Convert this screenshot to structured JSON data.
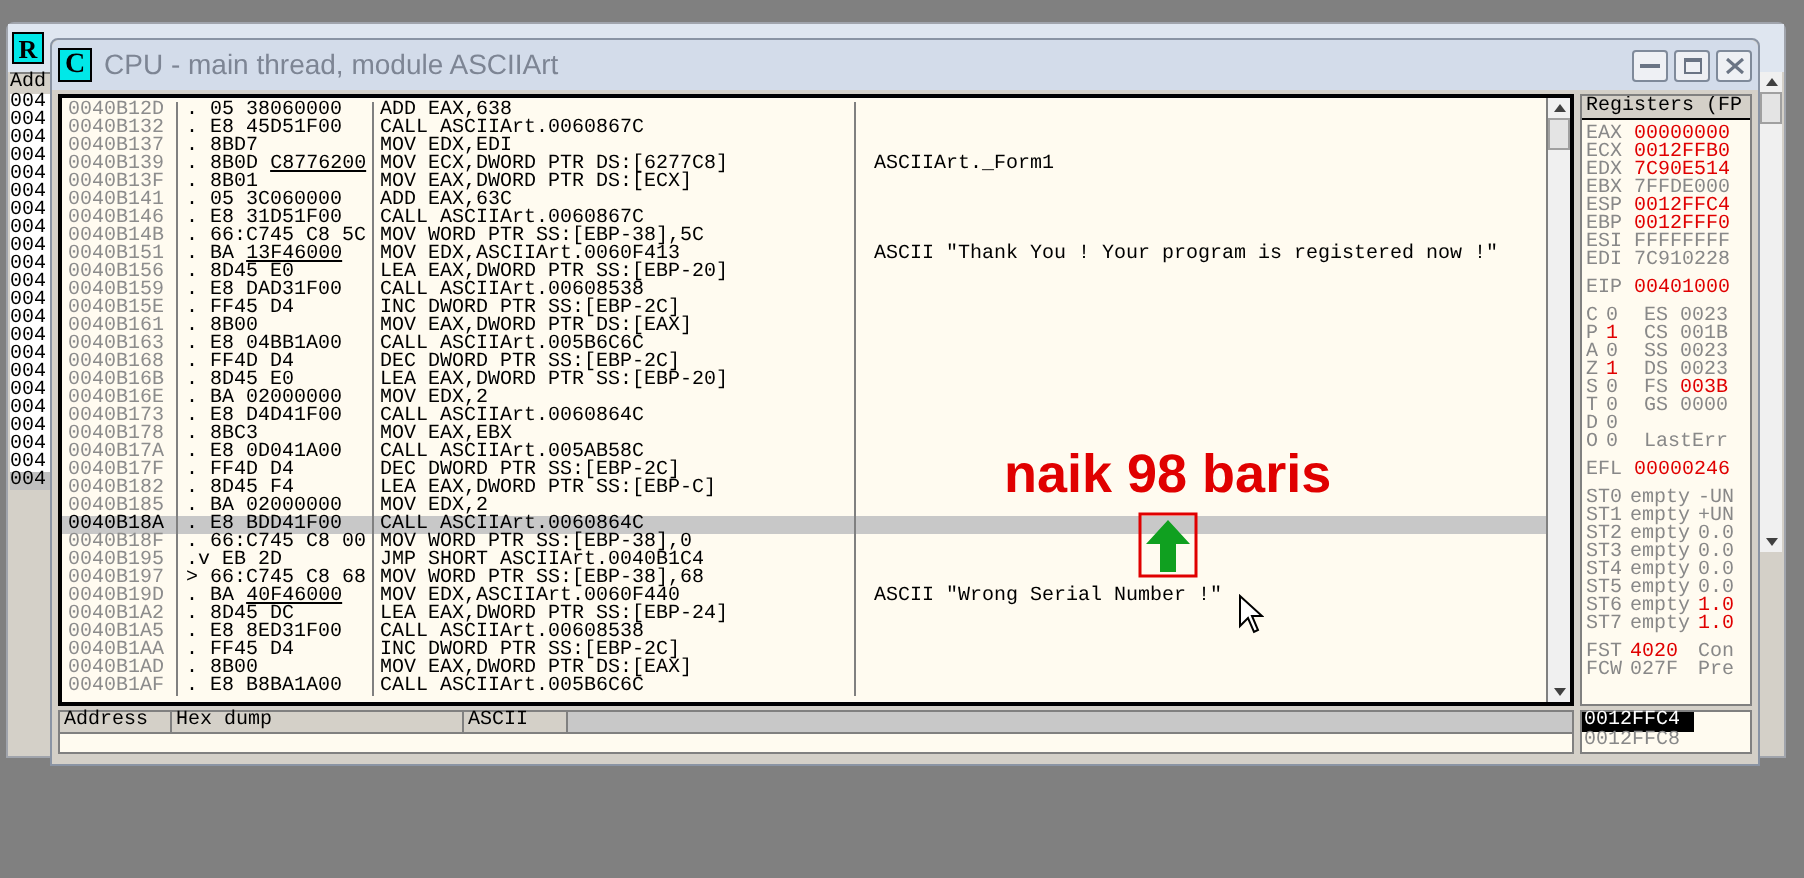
{
  "background_window": {
    "icon": "R",
    "column_header": "Add",
    "rows": [
      {
        "text": "004",
        "selected": false
      },
      {
        "text": "004",
        "selected": false
      },
      {
        "text": "004",
        "selected": false
      },
      {
        "text": "004",
        "selected": false
      },
      {
        "text": "004",
        "selected": false
      },
      {
        "text": "004",
        "selected": false
      },
      {
        "text": "004",
        "selected": false
      },
      {
        "text": "004",
        "selected": false
      },
      {
        "text": "004",
        "selected": false
      },
      {
        "text": "004",
        "selected": false
      },
      {
        "text": "004",
        "selected": false
      },
      {
        "text": "004",
        "selected": false
      },
      {
        "text": "004",
        "selected": false
      },
      {
        "text": "004",
        "selected": false
      },
      {
        "text": "004",
        "selected": false
      },
      {
        "text": "004",
        "selected": false
      },
      {
        "text": "004",
        "selected": false
      },
      {
        "text": "004",
        "selected": false
      },
      {
        "text": "004",
        "selected": false
      },
      {
        "text": "004",
        "selected": false
      },
      {
        "text": "004",
        "selected": false
      },
      {
        "text": "004",
        "selected": true
      }
    ]
  },
  "cpu_window": {
    "icon": "C",
    "title": "CPU - main thread, module ASCIIArt"
  },
  "disassembly": {
    "rows": [
      {
        "address": "0040B12D",
        "marker": ".",
        "hex": "05 38060000",
        "command": "ADD EAX,638",
        "selected": false
      },
      {
        "address": "0040B132",
        "marker": ".",
        "hex": "E8 45D51F00",
        "command": "CALL ASCIIArt.0060867C",
        "selected": false
      },
      {
        "address": "0040B137",
        "marker": ".",
        "hex": "8BD7",
        "command": "MOV EDX,EDI",
        "selected": false
      },
      {
        "address": "0040B139",
        "marker": ".",
        "hex": "8B0D",
        "fixup": "C8776200",
        "command": "MOV ECX,DWORD PTR DS:[6277C8]",
        "comment": "ASCIIArt._Form1",
        "selected": false
      },
      {
        "address": "0040B13F",
        "marker": ".",
        "hex": "8B01",
        "command": "MOV EAX,DWORD PTR DS:[ECX]",
        "selected": false
      },
      {
        "address": "0040B141",
        "marker": ".",
        "hex": "05 3C060000",
        "command": "ADD EAX,63C",
        "selected": false
      },
      {
        "address": "0040B146",
        "marker": ".",
        "hex": "E8 31D51F00",
        "command": "CALL ASCIIArt.0060867C",
        "selected": false
      },
      {
        "address": "0040B14B",
        "marker": ".",
        "hex": "66:C745 C8 5C",
        "command": "MOV WORD PTR SS:[EBP-38],5C",
        "selected": false
      },
      {
        "address": "0040B151",
        "marker": ".",
        "hex": "BA",
        "fixup": "13F46000",
        "command": "MOV EDX,ASCIIArt.0060F413",
        "comment": "ASCII \"Thank You ! Your program is registered now !\"",
        "selected": false
      },
      {
        "address": "0040B156",
        "marker": ".",
        "hex": "8D45 E0",
        "command": "LEA EAX,DWORD PTR SS:[EBP-20]",
        "selected": false
      },
      {
        "address": "0040B159",
        "marker": ".",
        "hex": "E8 DAD31F00",
        "command": "CALL ASCIIArt.00608538",
        "selected": false
      },
      {
        "address": "0040B15E",
        "marker": ".",
        "hex": "FF45 D4",
        "command": "INC DWORD PTR SS:[EBP-2C]",
        "selected": false
      },
      {
        "address": "0040B161",
        "marker": ".",
        "hex": "8B00",
        "command": "MOV EAX,DWORD PTR DS:[EAX]",
        "selected": false
      },
      {
        "address": "0040B163",
        "marker": ".",
        "hex": "E8 04BB1A00",
        "command": "CALL ASCIIArt.005B6C6C",
        "selected": false
      },
      {
        "address": "0040B168",
        "marker": ".",
        "hex": "FF4D D4",
        "command": "DEC DWORD PTR SS:[EBP-2C]",
        "selected": false
      },
      {
        "address": "0040B16B",
        "marker": ".",
        "hex": "8D45 E0",
        "command": "LEA EAX,DWORD PTR SS:[EBP-20]",
        "selected": false
      },
      {
        "address": "0040B16E",
        "marker": ".",
        "hex": "BA 02000000",
        "command": "MOV EDX,2",
        "selected": false
      },
      {
        "address": "0040B173",
        "marker": ".",
        "hex": "E8 D4D41F00",
        "command": "CALL ASCIIArt.0060864C",
        "selected": false
      },
      {
        "address": "0040B178",
        "marker": ".",
        "hex": "8BC3",
        "command": "MOV EAX,EBX",
        "selected": false
      },
      {
        "address": "0040B17A",
        "marker": ".",
        "hex": "E8 0D041A00",
        "command": "CALL ASCIIArt.005AB58C",
        "selected": false
      },
      {
        "address": "0040B17F",
        "marker": ".",
        "hex": "FF4D D4",
        "command": "DEC DWORD PTR SS:[EBP-2C]",
        "selected": false
      },
      {
        "address": "0040B182",
        "marker": ".",
        "hex": "8D45 F4",
        "command": "LEA EAX,DWORD PTR SS:[EBP-C]",
        "selected": false
      },
      {
        "address": "0040B185",
        "marker": ".",
        "hex": "BA 02000000",
        "command": "MOV EDX,2",
        "selected": false
      },
      {
        "address": "0040B18A",
        "marker": ".",
        "hex": "E8 BDD41F00",
        "command": "CALL ASCIIArt.0060864C",
        "selected": true
      },
      {
        "address": "0040B18F",
        "marker": ".",
        "hex": "66:C745 C8 00",
        "command": "MOV WORD PTR SS:[EBP-38],0",
        "selected": false
      },
      {
        "address": "0040B195",
        "marker": ".v",
        "hex": "EB 2D",
        "command": "JMP SHORT ASCIIArt.0040B1C4",
        "selected": false
      },
      {
        "address": "0040B197",
        "marker": ">",
        "hex": "66:C745 C8 68",
        "command": "MOV WORD PTR SS:[EBP-38],68",
        "selected": false
      },
      {
        "address": "0040B19D",
        "marker": ".",
        "hex": "BA",
        "fixup": "40F46000",
        "command": "MOV EDX,ASCIIArt.0060F440",
        "comment": "ASCII \"Wrong Serial Number !\"",
        "selected": false
      },
      {
        "address": "0040B1A2",
        "marker": ".",
        "hex": "8D45 DC",
        "command": "LEA EAX,DWORD PTR SS:[EBP-24]",
        "selected": false
      },
      {
        "address": "0040B1A5",
        "marker": ".",
        "hex": "E8 8ED31F00",
        "command": "CALL ASCIIArt.00608538",
        "selected": false
      },
      {
        "address": "0040B1AA",
        "marker": ".",
        "hex": "FF45 D4",
        "command": "INC DWORD PTR SS:[EBP-2C]",
        "selected": false
      },
      {
        "address": "0040B1AD",
        "marker": ".",
        "hex": "8B00",
        "command": "MOV EAX,DWORD PTR DS:[EAX]",
        "selected": false
      },
      {
        "address": "0040B1AF",
        "marker": ".",
        "hex": "E8 B8BA1A00",
        "command": "CALL ASCIIArt.005B6C6C",
        "selected": false
      }
    ]
  },
  "registers": {
    "header": "Registers (FP",
    "groups": [
      [
        {
          "kind": "reg",
          "cells": [
            {
              "text": "EAX",
              "changed": false
            },
            {
              "text": "00000000",
              "changed": true
            }
          ]
        },
        {
          "kind": "reg",
          "cells": [
            {
              "text": "ECX",
              "changed": false
            },
            {
              "text": "0012FFB0",
              "changed": true
            }
          ]
        },
        {
          "kind": "reg",
          "cells": [
            {
              "text": "EDX",
              "changed": false
            },
            {
              "text": "7C90E514",
              "changed": true
            }
          ]
        },
        {
          "kind": "reg",
          "cells": [
            {
              "text": "EBX",
              "changed": false
            },
            {
              "text": "7FFDE000",
              "changed": false
            }
          ]
        },
        {
          "kind": "reg",
          "cells": [
            {
              "text": "ESP",
              "changed": false
            },
            {
              "text": "0012FFC4",
              "changed": true
            }
          ]
        },
        {
          "kind": "reg",
          "cells": [
            {
              "text": "EBP",
              "changed": false
            },
            {
              "text": "0012FFF0",
              "changed": true
            }
          ]
        },
        {
          "kind": "reg",
          "cells": [
            {
              "text": "ESI",
              "changed": false
            },
            {
              "text": "FFFFFFFF",
              "changed": false
            }
          ]
        },
        {
          "kind": "reg",
          "cells": [
            {
              "text": "EDI",
              "changed": false
            },
            {
              "text": "7C910228",
              "changed": false
            }
          ]
        }
      ],
      [
        {
          "kind": "reg",
          "cells": [
            {
              "text": "EIP",
              "changed": false
            },
            {
              "text": "00401000",
              "changed": true
            }
          ]
        }
      ],
      [
        {
          "kind": "flag",
          "cells": [
            {
              "text": "C",
              "changed": false
            },
            {
              "text": "0",
              "changed": false
            },
            {
              "text": "ES",
              "changed": false
            },
            {
              "text": "0023",
              "changed": false
            }
          ]
        },
        {
          "kind": "flag",
          "cells": [
            {
              "text": "P",
              "changed": false
            },
            {
              "text": "1",
              "changed": true
            },
            {
              "text": "CS",
              "changed": false
            },
            {
              "text": "001B",
              "changed": false
            }
          ]
        },
        {
          "kind": "flag",
          "cells": [
            {
              "text": "A",
              "changed": false
            },
            {
              "text": "0",
              "changed": false
            },
            {
              "text": "SS",
              "changed": false
            },
            {
              "text": "0023",
              "changed": false
            }
          ]
        },
        {
          "kind": "flag",
          "cells": [
            {
              "text": "Z",
              "changed": false
            },
            {
              "text": "1",
              "changed": true
            },
            {
              "text": "DS",
              "changed": false
            },
            {
              "text": "0023",
              "changed": false
            }
          ]
        },
        {
          "kind": "flag",
          "cells": [
            {
              "text": "S",
              "changed": false
            },
            {
              "text": "0",
              "changed": false
            },
            {
              "text": "FS",
              "changed": false
            },
            {
              "text": "003B",
              "changed": true
            }
          ]
        },
        {
          "kind": "flag",
          "cells": [
            {
              "text": "T",
              "changed": false
            },
            {
              "text": "0",
              "changed": false
            },
            {
              "text": "GS",
              "changed": false
            },
            {
              "text": "0000",
              "changed": false
            }
          ]
        },
        {
          "kind": "flag",
          "cells": [
            {
              "text": "D",
              "changed": false
            },
            {
              "text": "0",
              "changed": false
            }
          ]
        },
        {
          "kind": "flag",
          "cells": [
            {
              "text": "O",
              "changed": false
            },
            {
              "text": "0",
              "changed": false
            },
            {
              "text": "LastErr",
              "changed": false
            }
          ]
        }
      ],
      [
        {
          "kind": "reg",
          "cells": [
            {
              "text": "EFL",
              "changed": false
            },
            {
              "text": "00000246",
              "changed": true
            }
          ]
        }
      ],
      [
        {
          "kind": "fpu",
          "cells": [
            {
              "text": "ST0",
              "changed": false
            },
            {
              "text": "empty",
              "changed": false
            },
            {
              "text": "-UN",
              "changed": false
            }
          ]
        },
        {
          "kind": "fpu",
          "cells": [
            {
              "text": "ST1",
              "changed": false
            },
            {
              "text": "empty",
              "changed": false
            },
            {
              "text": "+UN",
              "changed": false
            }
          ]
        },
        {
          "kind": "fpu",
          "cells": [
            {
              "text": "ST2",
              "changed": false
            },
            {
              "text": "empty",
              "changed": false
            },
            {
              "text": "0.0",
              "changed": false
            }
          ]
        },
        {
          "kind": "fpu",
          "cells": [
            {
              "text": "ST3",
              "changed": false
            },
            {
              "text": "empty",
              "changed": false
            },
            {
              "text": "0.0",
              "changed": false
            }
          ]
        },
        {
          "kind": "fpu",
          "cells": [
            {
              "text": "ST4",
              "changed": false
            },
            {
              "text": "empty",
              "changed": false
            },
            {
              "text": "0.0",
              "changed": false
            }
          ]
        },
        {
          "kind": "fpu",
          "cells": [
            {
              "text": "ST5",
              "changed": false
            },
            {
              "text": "empty",
              "changed": false
            },
            {
              "text": "0.0",
              "changed": false
            }
          ]
        },
        {
          "kind": "fpu",
          "cells": [
            {
              "text": "ST6",
              "changed": false
            },
            {
              "text": "empty",
              "changed": false
            },
            {
              "text": "1.0",
              "changed": true
            }
          ]
        },
        {
          "kind": "fpu",
          "cells": [
            {
              "text": "ST7",
              "changed": false
            },
            {
              "text": "empty",
              "changed": false
            },
            {
              "text": "1.0",
              "changed": true
            }
          ]
        }
      ],
      [
        {
          "kind": "fpu",
          "cells": [
            {
              "text": "FST",
              "changed": false
            },
            {
              "text": "4020",
              "changed": true
            },
            {
              "text": "Con",
              "changed": false
            }
          ]
        },
        {
          "kind": "fpu",
          "cells": [
            {
              "text": "FCW",
              "changed": false
            },
            {
              "text": "027F",
              "changed": false
            },
            {
              "text": "Pre",
              "changed": false
            }
          ]
        }
      ]
    ]
  },
  "dump": {
    "columns": [
      "Address",
      "Hex dump",
      "ASCII"
    ]
  },
  "stack": {
    "rows": [
      {
        "address": "0012FFC4",
        "selected": true
      },
      {
        "address": "0012FFC8",
        "selected": false
      }
    ]
  },
  "annotation": {
    "text": "naik 98 baris"
  }
}
